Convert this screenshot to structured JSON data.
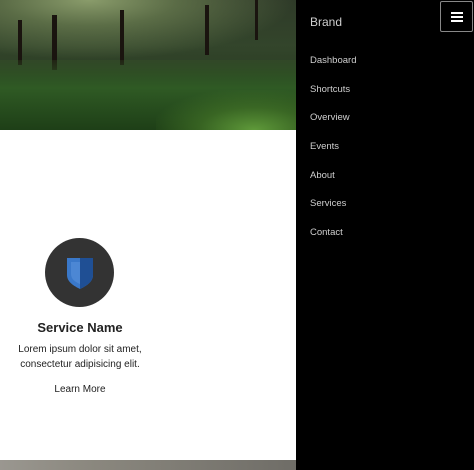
{
  "hero": {
    "image": "forest-hillside-photo"
  },
  "service": {
    "icon": "shield-icon",
    "icon_color": "#3a78c9",
    "title": "Service Name",
    "line1": "Lorem ipsum dolor sit amet,",
    "line2": "consectetur adipisicing elit.",
    "link": "Learn More"
  },
  "sidebar": {
    "brand": "Brand",
    "items": [
      {
        "label": "Dashboard"
      },
      {
        "label": "Shortcuts"
      },
      {
        "label": "Overview"
      },
      {
        "label": "Events"
      },
      {
        "label": "About"
      },
      {
        "label": "Services"
      },
      {
        "label": "Contact"
      }
    ]
  },
  "menu_toggle": {
    "icon": "hamburger-icon"
  },
  "colors": {
    "sidebar_bg": "#000000",
    "nav_text": "#cfcfcf",
    "circle_bg": "#333333"
  }
}
